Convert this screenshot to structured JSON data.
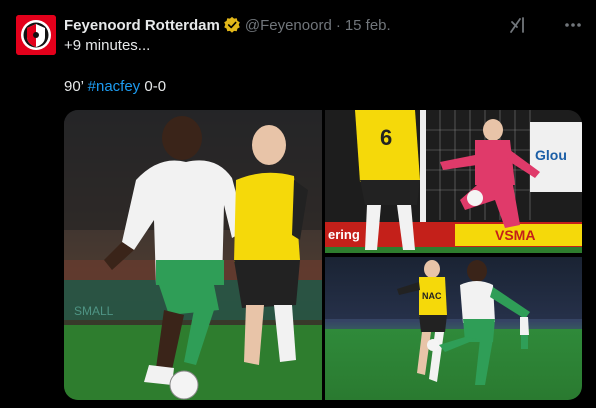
{
  "author": {
    "display_name": "Feyenoord Rotterdam",
    "handle": "@Feyenoord",
    "separator": "·",
    "date": "15 feb.",
    "verified_badge_color": "#e2b719",
    "avatar_color": "#e3001b"
  },
  "icons": {
    "grok": "grok-icon",
    "more": "more-options-icon",
    "verified": "verified-badge-icon"
  },
  "tweet": {
    "line1": "+9 minutes...",
    "line2_prefix": "90’",
    "hashtag": "#nacfey",
    "line2_suffix": "0-0",
    "hashtag_color": "#1d9bf0"
  },
  "photos": {
    "left_ad": "SMALL",
    "top_ad_left": "ering",
    "top_ad_right": "VSMA",
    "top_board": "Glou",
    "top_player_number": "6",
    "bottom_chest": "NAC"
  },
  "colors": {
    "background": "#000000",
    "text": "#e7e9ea",
    "muted": "#71767b",
    "nac_yellow": "#f5d90a",
    "feyenoord_green": "#1f8a4c"
  }
}
